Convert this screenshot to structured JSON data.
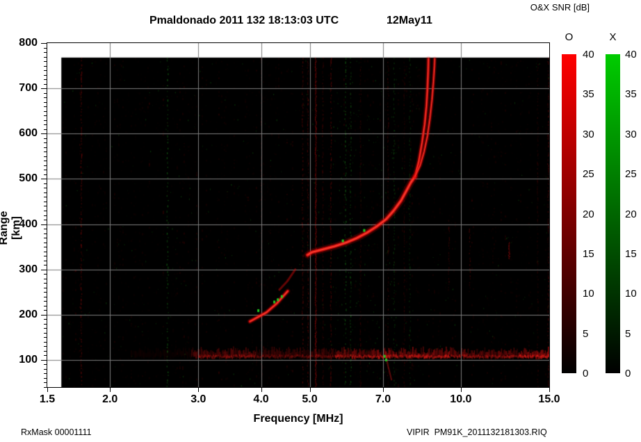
{
  "header": {
    "colorbar_title": "O&X SNR [dB]"
  },
  "title": "Pmaldonado 2011 132 18:13:03 UTC",
  "date_label": "12May11",
  "footer": {
    "left": "RxMask 00001111",
    "right": "VIPIR  PM91K_2011132181303.RIQ"
  },
  "chart_data": {
    "type": "heatmap",
    "title": "Pmaldonado 2011 132 18:13:03 UTC",
    "date_label": "12May11",
    "xlabel": "Frequency [MHz]",
    "ylabel": "Range [km]",
    "colorbar_title": "O&X SNR [dB]",
    "x_scale": "log",
    "xlim": [
      1.5,
      15.0
    ],
    "ylim": [
      40,
      800
    ],
    "x_ticks": [
      1.5,
      2.0,
      3.0,
      4.0,
      5.0,
      7.0,
      10.0,
      15.0
    ],
    "x_tick_labels": [
      "1.5",
      "2.0",
      "3.0",
      "4.0",
      "5.0",
      "7.0",
      "10.0",
      "15.0"
    ],
    "y_ticks": [
      100,
      200,
      300,
      400,
      500,
      600,
      700,
      800
    ],
    "y_minor_step": 10,
    "grid": true,
    "grid_color": "#7d7d7d",
    "background": "#000000",
    "data_extent": {
      "f_min_mhz": 1.6,
      "f_max_mhz": 15.0,
      "range_min_km": 40,
      "range_max_km": 768
    },
    "colorbars": [
      {
        "label": "O",
        "top_color": "#ff0000",
        "bottom_color": "#000000",
        "range_db": [
          0,
          40
        ],
        "ticks": [
          0,
          5,
          10,
          15,
          20,
          25,
          30,
          35,
          40
        ]
      },
      {
        "label": "X",
        "top_color": "#00cc00",
        "bottom_color": "#000000",
        "range_db": [
          0,
          40
        ],
        "ticks": [
          0,
          5,
          10,
          15,
          20,
          25,
          30,
          35,
          40
        ]
      }
    ],
    "traces": {
      "f_layer_main_o": {
        "color": "#e01010",
        "points_f_mhz_range_km": [
          [
            4.95,
            332
          ],
          [
            5.05,
            338
          ],
          [
            5.3,
            344
          ],
          [
            5.6,
            351
          ],
          [
            5.9,
            359
          ],
          [
            6.2,
            369
          ],
          [
            6.5,
            381
          ],
          [
            6.8,
            395
          ],
          [
            7.1,
            411
          ],
          [
            7.35,
            430
          ],
          [
            7.6,
            452
          ],
          [
            7.8,
            475
          ],
          [
            7.95,
            492
          ],
          [
            8.1,
            505
          ]
        ]
      },
      "f_layer_o_branch": [
        [
          8.1,
          505
        ],
        [
          8.25,
          540
        ],
        [
          8.37,
          580
        ],
        [
          8.47,
          620
        ],
        [
          8.54,
          660
        ],
        [
          8.58,
          700
        ],
        [
          8.61,
          740
        ],
        [
          8.62,
          765
        ]
      ],
      "f_layer_x_branch": [
        [
          8.1,
          505
        ],
        [
          8.3,
          530
        ],
        [
          8.45,
          560
        ],
        [
          8.58,
          595
        ],
        [
          8.68,
          635
        ],
        [
          8.76,
          675
        ],
        [
          8.82,
          715
        ],
        [
          8.86,
          750
        ],
        [
          8.87,
          765
        ]
      ],
      "es_slant_bright": [
        [
          3.8,
          185
        ],
        [
          4.1,
          205
        ],
        [
          4.3,
          225
        ],
        [
          4.52,
          252
        ]
      ],
      "es_slant_faint": [
        [
          4.35,
          255
        ],
        [
          4.52,
          275
        ],
        [
          4.68,
          300
        ]
      ],
      "e_band": {
        "center_km": 110,
        "thickness_km": 20,
        "f_start": 2.2,
        "f_end": 15.0,
        "segments": [
          {
            "f0": 2.2,
            "f1": 2.9,
            "amp": 0.1
          },
          {
            "f0": 2.9,
            "f1": 3.9,
            "amp": 0.5
          },
          {
            "f0": 3.9,
            "f1": 5.6,
            "amp": 0.35
          },
          {
            "f0": 5.6,
            "f1": 6.5,
            "amp": 0.6
          },
          {
            "f0": 6.5,
            "f1": 9.5,
            "amp": 0.75
          },
          {
            "f0": 9.5,
            "f1": 13.0,
            "amp": 0.55
          },
          {
            "f0": 13.0,
            "f1": 15.0,
            "amp": 0.8
          }
        ]
      },
      "green_dots_f_mhz_range_km": [
        [
          3.95,
          209
        ],
        [
          4.25,
          228
        ],
        [
          4.32,
          233
        ],
        [
          4.4,
          240
        ],
        [
          5.82,
          363
        ],
        [
          6.42,
          386
        ],
        [
          7.05,
          108
        ],
        [
          7.1,
          100
        ]
      ],
      "below_band_arc": [
        [
          7.08,
          118
        ],
        [
          7.15,
          90
        ],
        [
          7.28,
          55
        ]
      ],
      "rfi_red_columns": [
        {
          "f": 1.75,
          "alpha": 0.45,
          "r0": 40,
          "r1": 768,
          "dotted": true
        },
        {
          "f": 4.0,
          "alpha": 0.2,
          "r0": 40,
          "r1": 768,
          "dotted": true
        },
        {
          "f": 4.83,
          "alpha": 0.35,
          "r0": 40,
          "r1": 768,
          "dotted": true
        },
        {
          "f": 4.95,
          "alpha": 0.3,
          "r0": 40,
          "r1": 768,
          "dotted": true
        },
        {
          "f": 5.13,
          "alpha": 0.55,
          "r0": 40,
          "r1": 768,
          "dotted": false
        },
        {
          "f": 5.3,
          "alpha": 0.25,
          "r0": 40,
          "r1": 768,
          "dotted": true
        },
        {
          "f": 5.5,
          "alpha": 0.4,
          "r0": 40,
          "r1": 768,
          "dotted": true
        },
        {
          "f": 6.3,
          "alpha": 0.2,
          "r0": 40,
          "r1": 768,
          "dotted": true
        },
        {
          "f": 7.15,
          "alpha": 0.25,
          "r0": 40,
          "r1": 768,
          "dotted": true
        },
        {
          "f": 7.7,
          "alpha": 0.2,
          "r0": 40,
          "r1": 768,
          "dotted": true
        },
        {
          "f": 9.45,
          "alpha": 0.25,
          "r0": 250,
          "r1": 420,
          "dotted": true
        },
        {
          "f": 10.4,
          "alpha": 0.3,
          "r0": 250,
          "r1": 390,
          "dotted": true
        },
        {
          "f": 12.45,
          "alpha": 0.6,
          "r0": 325,
          "r1": 360,
          "dotted": false
        },
        {
          "f": 14.2,
          "alpha": 0.2,
          "r0": 40,
          "r1": 768,
          "dotted": true
        },
        {
          "f": 14.9,
          "alpha": 0.3,
          "r0": 40,
          "r1": 768,
          "dotted": true
        }
      ],
      "rfi_green_columns": [
        {
          "f": 2.6,
          "alpha": 0.5
        },
        {
          "f": 5.88,
          "alpha": 0.45
        },
        {
          "f": 6.02,
          "alpha": 0.4
        },
        {
          "f": 7.35,
          "alpha": 0.3
        },
        {
          "f": 7.9,
          "alpha": 0.25
        }
      ]
    }
  }
}
